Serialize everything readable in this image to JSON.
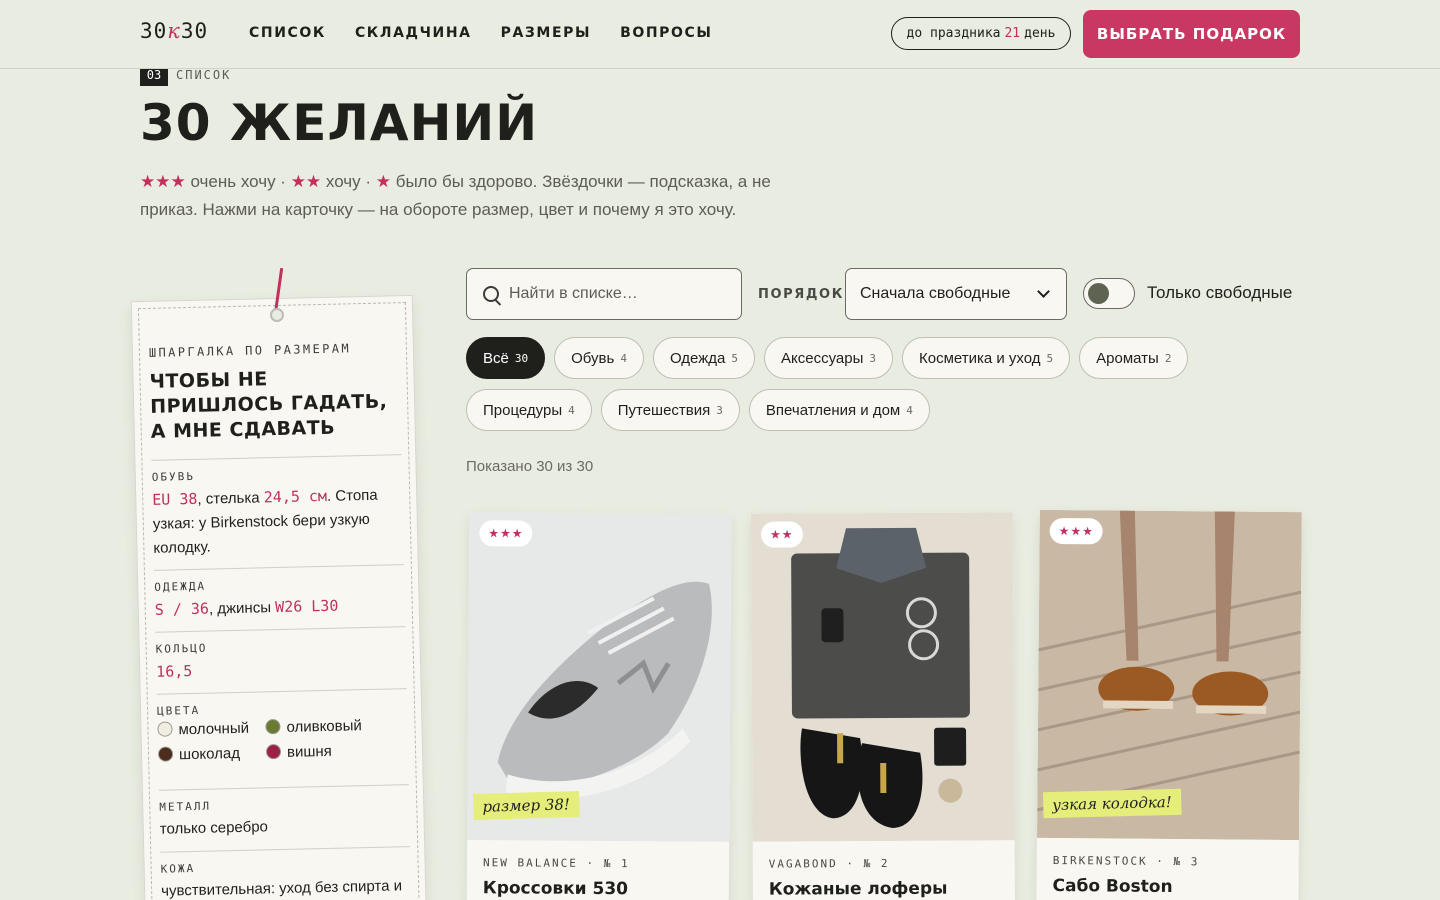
{
  "header": {
    "logo_left": "30",
    "logo_mid": "к",
    "logo_right": "30",
    "nav": [
      "СПИСОК",
      "СКЛАДЧИНА",
      "РАЗМЕРЫ",
      "ВОПРОСЫ"
    ],
    "countdown_prefix": "до праздника",
    "countdown_num": "21",
    "countdown_suffix": "день",
    "cta": "ВЫБРАТЬ ПОДАРОК"
  },
  "section": {
    "number": "03",
    "label": "СПИСОК",
    "title": "30 ЖЕЛАНИЙ",
    "intro_stars3": "★★★",
    "intro_t1": " очень хочу · ",
    "intro_stars2": "★★",
    "intro_t2": " хочу · ",
    "intro_stars1": "★",
    "intro_t3": " было бы здорово. Звёздочки — подсказка, а не приказ. Нажми на карточку — на обороте размер, цвет и почему я это хочу."
  },
  "cheatsheet": {
    "small": "ШПАРГАЛКА ПО РАЗМЕРАМ",
    "title": "ЧТОБЫ НЕ ПРИШЛОСЬ ГАДАТЬ, А МНЕ СДАВАТЬ",
    "shoes_label": "ОБУВЬ",
    "shoes_eu": "EU 38",
    "shoes_t1": ", стелька ",
    "shoes_cm": "24,5 см",
    "shoes_t2": ". Стопа узкая: у Birkenstock бери узкую колодку.",
    "clothes_label": "ОДЕЖДА",
    "clothes_size": "S / 36",
    "clothes_t1": ", джинсы ",
    "clothes_jeans": "W26 L30",
    "ring_label": "КОЛЬЦО",
    "ring_value": "16,5",
    "colors_label": "ЦВЕТА",
    "colors": [
      {
        "name": "молочный",
        "hex": "#f1ece0"
      },
      {
        "name": "оливковый",
        "hex": "#6b7a32"
      },
      {
        "name": "шоколад",
        "hex": "#4d2d1d"
      },
      {
        "name": "вишня",
        "hex": "#9b2146"
      }
    ],
    "metal_label": "МЕТАЛЛ",
    "metal_value": "только серебро",
    "skin_label": "КОЖА",
    "skin_value": "чувствительная: уход без спирта и"
  },
  "filters": {
    "search_placeholder": "Найти в списке…",
    "order_label": "ПОРЯДОК",
    "order_value": "Сначала свободные",
    "toggle_label": "Только свободные",
    "chips": [
      {
        "label": "Всё",
        "count": "30"
      },
      {
        "label": "Обувь",
        "count": "4"
      },
      {
        "label": "Одежда",
        "count": "5"
      },
      {
        "label": "Аксессуары",
        "count": "3"
      },
      {
        "label": "Косметика и уход",
        "count": "5"
      },
      {
        "label": "Ароматы",
        "count": "2"
      },
      {
        "label": "Процедуры",
        "count": "4"
      },
      {
        "label": "Путешествия",
        "count": "3"
      },
      {
        "label": "Впечатления и дом",
        "count": "4"
      }
    ],
    "shown": "Показано 30 из 30"
  },
  "cards": [
    {
      "stars": "★★★",
      "note": "размер 38!",
      "brand": "NEW BALANCE",
      "num": "№ 1",
      "name": "Кроссовки 530"
    },
    {
      "stars": "★★",
      "note": "",
      "brand": "VAGABOND",
      "num": "№ 2",
      "name": "Кожаные лоферы"
    },
    {
      "stars": "★★★",
      "note": "узкая колодка!",
      "brand": "BIRKENSTOCK",
      "num": "№ 3",
      "name": "Сабо Boston"
    }
  ],
  "colors": {
    "accent": "#c3305e",
    "background": "#e9ece0",
    "card": "#f8f7f2",
    "note": "#e5ed7b"
  }
}
